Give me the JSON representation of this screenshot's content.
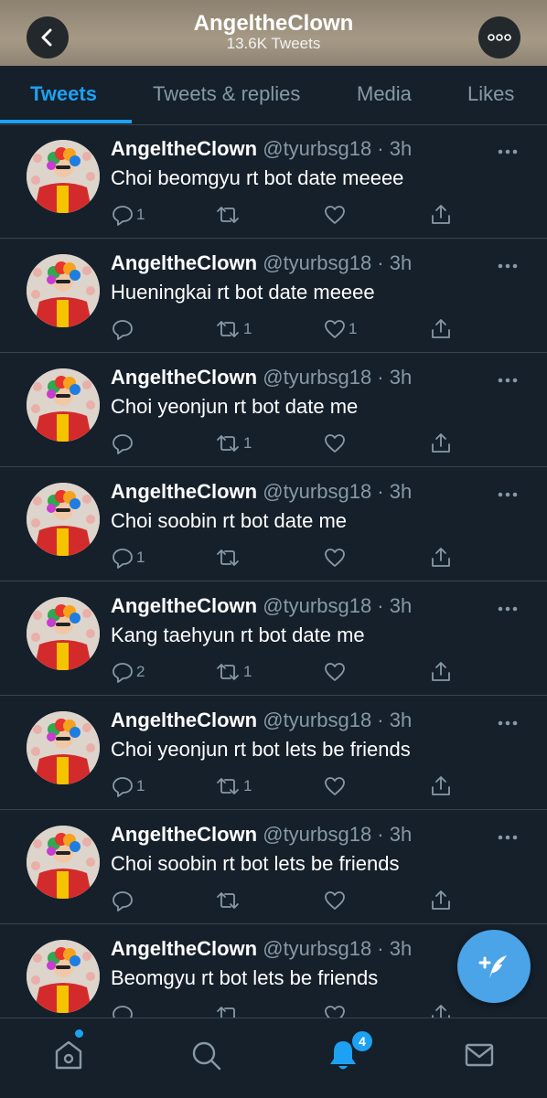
{
  "header": {
    "title": "AngeltheClown",
    "subtitle": "13.6K Tweets",
    "back_icon": "chevron-left-icon",
    "more_icon": "more-horizontal-icon",
    "banner_color": "#a69a86"
  },
  "tabs": [
    {
      "label": "Tweets",
      "active": true
    },
    {
      "label": "Tweets & replies",
      "active": false
    },
    {
      "label": "Media",
      "active": false
    },
    {
      "label": "Likes",
      "active": false
    }
  ],
  "tweets": [
    {
      "name": "AngeltheClown",
      "meta": "@tyurbsg18 · 3h",
      "text": "Choi beomgyu rt bot date meeee",
      "replies": "1",
      "retweets": "",
      "likes": ""
    },
    {
      "name": "AngeltheClown",
      "meta": "@tyurbsg18 · 3h",
      "text": "Hueningkai rt bot date meeee",
      "replies": "",
      "retweets": "1",
      "likes": "1"
    },
    {
      "name": "AngeltheClown",
      "meta": "@tyurbsg18 · 3h",
      "text": "Choi yeonjun rt bot date me",
      "replies": "",
      "retweets": "1",
      "likes": ""
    },
    {
      "name": "AngeltheClown",
      "meta": "@tyurbsg18 · 3h",
      "text": "Choi soobin rt bot date me",
      "replies": "1",
      "retweets": "",
      "likes": ""
    },
    {
      "name": "AngeltheClown",
      "meta": "@tyurbsg18 · 3h",
      "text": "Kang taehyun rt bot date me",
      "replies": "2",
      "retweets": "1",
      "likes": ""
    },
    {
      "name": "AngeltheClown",
      "meta": "@tyurbsg18 · 3h",
      "text": "Choi yeonjun rt bot lets be friends",
      "replies": "1",
      "retweets": "1",
      "likes": ""
    },
    {
      "name": "AngeltheClown",
      "meta": "@tyurbsg18 · 3h",
      "text": "Choi soobin rt bot lets be friends",
      "replies": "",
      "retweets": "",
      "likes": ""
    },
    {
      "name": "AngeltheClown",
      "meta": "@tyurbsg18 · 3h",
      "text": "Beomgyu rt bot lets be friends",
      "replies": "",
      "retweets": "",
      "likes": ""
    }
  ],
  "compose_icon": "compose-tweet-icon",
  "bottom_nav": {
    "items": [
      "home-icon",
      "search-icon",
      "notifications-icon",
      "messages-icon"
    ],
    "notification_count": "4"
  },
  "colors": {
    "background": "#15202b",
    "accent": "#1da1f2",
    "secondary_text": "#8899a6",
    "divider": "#38444d"
  }
}
